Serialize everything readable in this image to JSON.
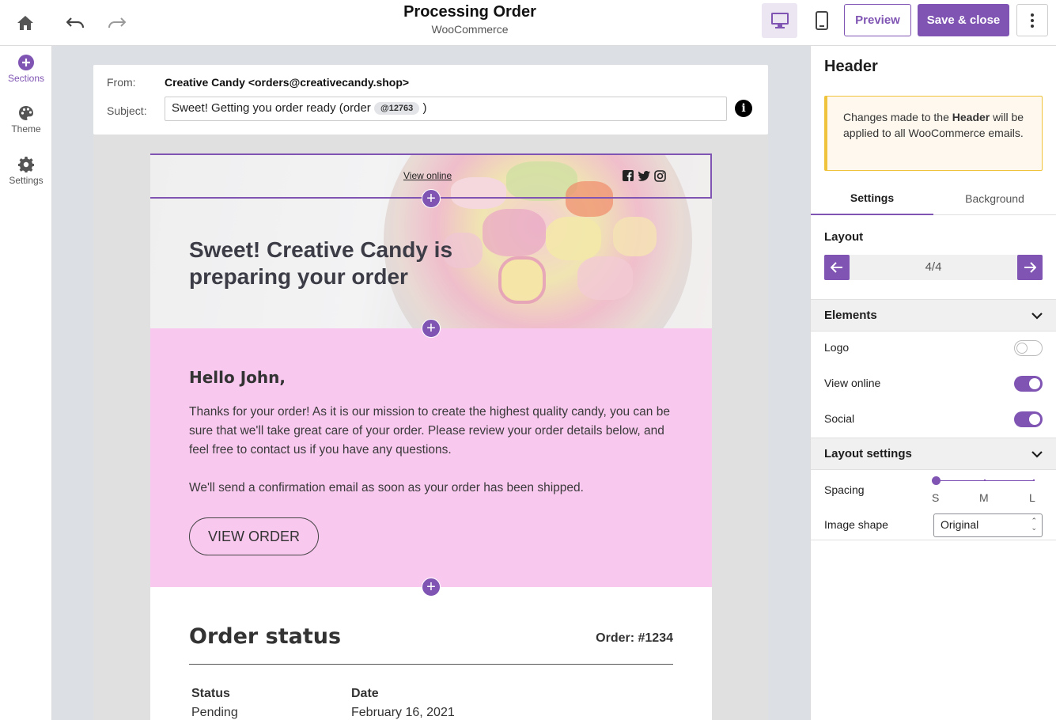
{
  "topbar": {
    "title": "Processing Order",
    "subtitle": "WooCommerce",
    "preview_label": "Preview",
    "save_label": "Save & close",
    "accent": "#7f54b3"
  },
  "leftbar": {
    "items": [
      {
        "label": "Sections",
        "icon": "plus-circle-icon"
      },
      {
        "label": "Theme",
        "icon": "palette-icon"
      },
      {
        "label": "Settings",
        "icon": "gear-icon"
      }
    ]
  },
  "email": {
    "from_label": "From:",
    "from_value": "Creative Candy <orders@creativecandy.shop>",
    "subject_label": "Subject:",
    "subject_text": "Sweet! Getting you order ready (order",
    "subject_tag": "@12763",
    "subject_end": ")",
    "view_online": "View online",
    "hero_title": "Sweet! Creative Candy is preparing your order",
    "greeting": "Hello John,",
    "para1": "Thanks for your order! As it is our mission to create the highest quality candy, you can be sure that we'll take great care of your order. Please review your order details below, and feel free to contact us if you have any questions.",
    "para2": "We'll send a confirmation email as soon as your order has been shipped.",
    "button": "VIEW ORDER",
    "status_title": "Order status",
    "order_number": "Order: #1234",
    "status_header": "Status",
    "status_value": "Pending",
    "date_header": "Date",
    "date_value": "February 16, 2021",
    "pink_bg": "#f9c8ef"
  },
  "panel": {
    "title": "Header",
    "notice_pre": "Changes made to the ",
    "notice_bold": "Header",
    "notice_post": " will be applied to all WooCommerce emails.",
    "tab_settings": "Settings",
    "tab_background": "Background",
    "layout_label": "Layout",
    "layout_count": "4/4",
    "elements_label": "Elements",
    "logo_label": "Logo",
    "logo_on": false,
    "view_online_label": "View online",
    "view_online_on": true,
    "social_label": "Social",
    "social_on": true,
    "layout_settings_label": "Layout settings",
    "spacing_label": "Spacing",
    "spacing_options": [
      "S",
      "M",
      "L"
    ],
    "spacing_value": "S",
    "image_shape_label": "Image shape",
    "image_shape_value": "Original"
  }
}
